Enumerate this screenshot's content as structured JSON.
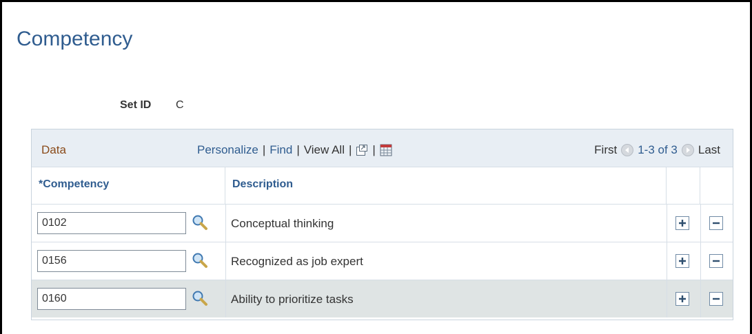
{
  "page": {
    "title": "Competency"
  },
  "set_id": {
    "label": "Set ID",
    "value": "C"
  },
  "grid": {
    "title": "Data",
    "nav": {
      "personalize": "Personalize",
      "find": "Find",
      "view_all": "View All",
      "separator": "|"
    },
    "paging": {
      "first": "First",
      "range": "1-3 of 3",
      "last": "Last"
    },
    "columns": {
      "competency": "*Competency",
      "description": "Description"
    },
    "rows": [
      {
        "code": "0102",
        "description": "Conceptual thinking"
      },
      {
        "code": "0156",
        "description": "Recognized as job expert"
      },
      {
        "code": "0160",
        "description": "Ability to prioritize tasks"
      }
    ]
  },
  "colors": {
    "title_blue": "#2f5c8f",
    "grid_title_brown": "#8a4b1a",
    "header_bg": "#e8eef4",
    "alt_row_bg": "#dfe4e4"
  },
  "icons": [
    "lookup-icon",
    "new-window-icon",
    "spreadsheet-icon",
    "previous-arrow-icon",
    "next-arrow-icon",
    "add-row-icon",
    "delete-row-icon"
  ]
}
